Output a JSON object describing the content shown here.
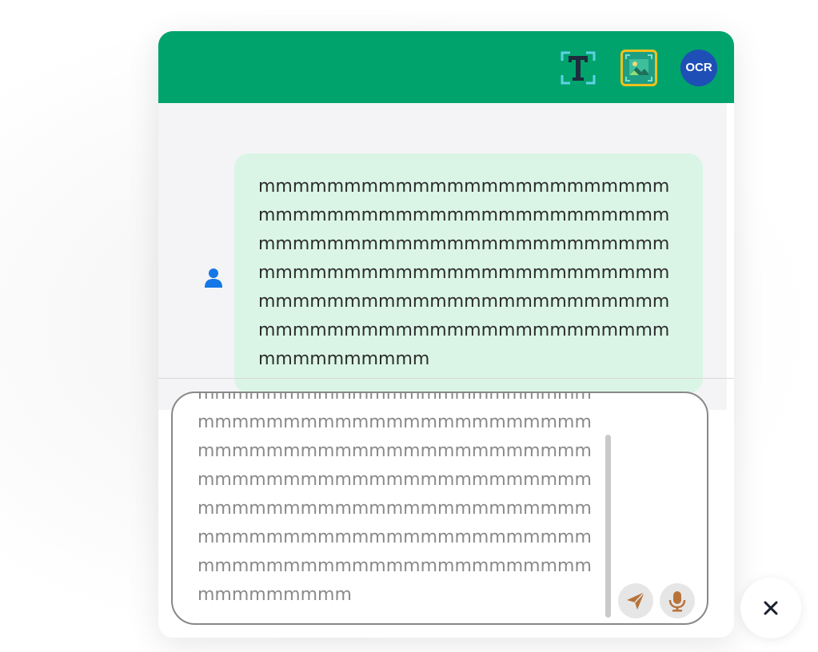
{
  "header": {
    "background_color": "#00a36c",
    "tools": [
      {
        "name": "text-recognition-icon"
      },
      {
        "name": "image-recognition-icon",
        "active_border_color": "#f2c01e"
      },
      {
        "name": "ocr-icon",
        "label": "OCR"
      }
    ]
  },
  "conversation": {
    "messages": [
      {
        "sender": "user",
        "avatar_icon": "user-icon",
        "text": "mmmmmmmmmmmmmmmmmmmmmmmmmmmmmmmmmmmmmmmmmmmmmmmmmmmmmmmmmmmmmmmmmmmmmmmmmmmmmmmmmmmmmmmmmmmmmmmmmmmmmmmmmmmmmmmmmmmmmmmmmmmmmmmmmmmmmmmmmmmmmmmmmmmmmmmmmm",
        "bubble_color": "#daf5e6"
      }
    ]
  },
  "composer": {
    "value": "mmmmmmmmmmmmmmmmmmmmmmmmmmmmmmmmmmmmmmmmmmmmmmmmmmmmmmmmmmmmmmmmmmmmmmmmmmmmmmmmmmmmmmmmmmmmmmmmmmmmmmmmmmmmmmmmmmmmmmmmmmmmmmmmmmmmmmmmmmmmmmmmmmmmmmmmmmmmmmmmmmmmmmmmmm",
    "send_icon": "paper-plane-icon",
    "mic_icon": "microphone-icon",
    "icon_color": "#b8733a"
  },
  "close_button": {
    "icon": "close-icon"
  }
}
